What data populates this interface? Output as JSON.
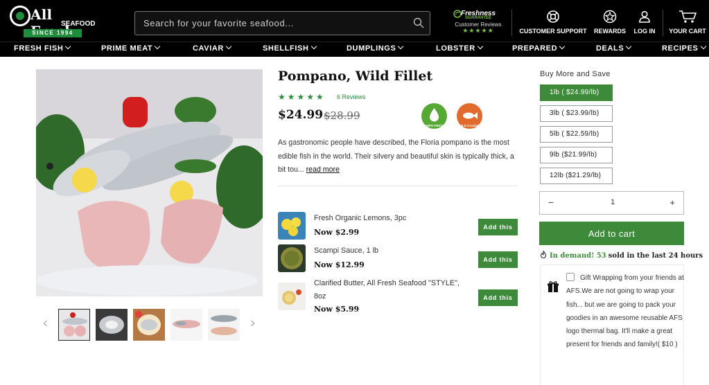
{
  "header": {
    "logo": {
      "brand": "All Fresh",
      "sub": "SEAFOOD",
      "since": "SINCE 1994"
    },
    "search": {
      "placeholder": "Search for your favorite seafood..."
    },
    "freshness": {
      "line1": "Freshness",
      "line2": "GUARANTEE",
      "line3": "Customer Reviews",
      "stars": "★★★★★"
    },
    "utilities": {
      "support": "CUSTOMER SUPPORT",
      "rewards": "REWARDS",
      "login": "LOG IN",
      "cart": "YOUR CART"
    },
    "nav": [
      "FRESH FISH",
      "PRIME MEAT",
      "CAVIAR",
      "SHELLFISH",
      "DUMPLINGS",
      "LOBSTER",
      "PREPARED",
      "DEALS",
      "RECIPES"
    ]
  },
  "product": {
    "title": "Pompano, Wild Fillet",
    "stars": "★★★★★",
    "reviews": "6 Reviews",
    "price": "$24.99",
    "old_price": "$28.99",
    "badges": {
      "ships_fresh": "SHIPS FRESH",
      "wild_caught": "WILD CAUGHT"
    },
    "description": "As gastronomic people have described, the Floria pompano is the most edible fish in the world. Their silvery and beautiful skin is typically thick, a bit tou...",
    "read_more": "read more"
  },
  "addons": [
    {
      "name": "Fresh Organic Lemons, 3pc",
      "price": "Now $2.99",
      "button": "Add this"
    },
    {
      "name": "Scampi Sauce, 1 lb",
      "price": "Now $12.99",
      "button": "Add this"
    },
    {
      "name": "Clarified Butter, All Fresh Seafood \"STYLE\", 8oz",
      "price": "Now $5.99",
      "button": "Add this"
    }
  ],
  "buy_more": {
    "title": "Buy More and Save",
    "options": [
      "1lb ( $24.99/lb)",
      "3lb ( $23.99/lb)",
      "5lb ( $22.59/lb)",
      "9lb ($21.99/lb)",
      "12lb ($21.29/lb)"
    ],
    "selected_index": 0
  },
  "quantity": {
    "minus": "−",
    "value": "1",
    "plus": "+"
  },
  "cart_button": "Add to cart",
  "demand": {
    "prefix": "In demand!",
    "count": "53",
    "suffix": "sold in the last 24 hours"
  },
  "gift": {
    "text": "Gift Wrapping from your friends at AFS.We are not going to wrap your fish... but we are going to pack your goodies in an awesome reusable AFS logo thermal bag. It'll make a great present for friends and family!( $10 )"
  },
  "colors": {
    "accent_green": "#3d8b3a",
    "header_bg": "#000000",
    "badge_green": "#55a834",
    "badge_orange": "#e26a2c"
  }
}
